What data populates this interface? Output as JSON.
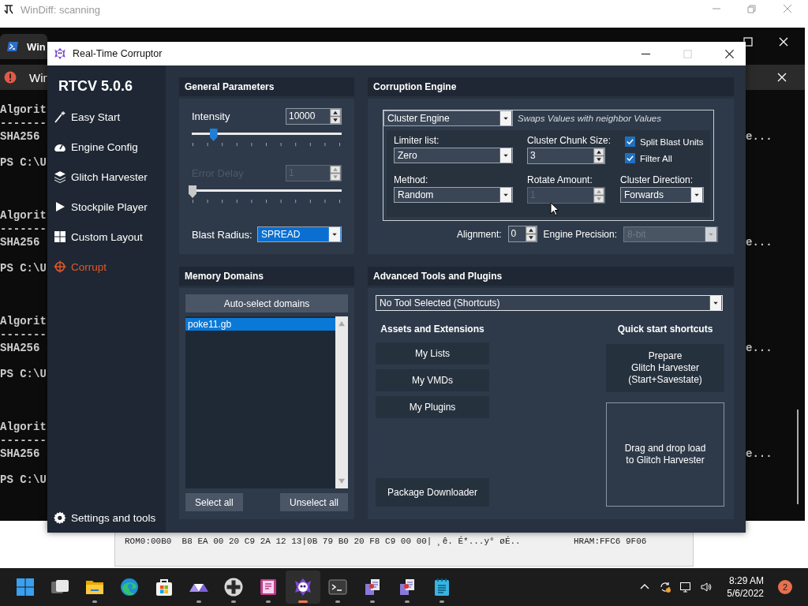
{
  "windiff": {
    "title": "WinDiff: scanning",
    "hex_line": "ROM0:00B0  B8 EA 00 20 C9 2A 12 13|0B 79 B0 20 F8 C9 00 00| ¸ê. É*...y° øÉ..",
    "register": "HRAM:FFC6 9F06"
  },
  "terminal": {
    "tab": "Win",
    "notice": "Win",
    "blocks": [
      {
        "header": "Algorit",
        "rule": "-------",
        "hash": "SHA256",
        "hash_end": "e...",
        "prompt": "PS C:\\U"
      },
      {
        "header": "Algorit",
        "rule": "-------",
        "hash": "SHA256",
        "hash_end": "e...",
        "prompt": "PS C:\\U"
      },
      {
        "header": "Algorit",
        "rule": "-------",
        "hash": "SHA256",
        "hash_end": "e...",
        "prompt": "PS C:\\U"
      },
      {
        "header": "Algorit",
        "rule": "-------",
        "hash": "SHA256",
        "hash_end": "e...",
        "prompt": "PS C:\\U"
      }
    ]
  },
  "rtcv": {
    "title": "Real-Time Corruptor",
    "version": "RTCV 5.0.6",
    "nav": [
      {
        "label": "Easy Start",
        "kind": "wand",
        "selected": false
      },
      {
        "label": "Engine Config",
        "kind": "gauge",
        "selected": false
      },
      {
        "label": "Glitch Harvester",
        "kind": "layers",
        "selected": false
      },
      {
        "label": "Stockpile Player",
        "kind": "play",
        "selected": false
      },
      {
        "label": "Custom Layout",
        "kind": "grid",
        "selected": false
      },
      {
        "label": "Corrupt",
        "kind": "crosshair",
        "selected": true
      }
    ],
    "settings": "Settings and tools",
    "general": {
      "title": "General Parameters",
      "sliders": [
        {
          "label": "Intensity",
          "value": "10000",
          "level": 0.14,
          "disabled": false
        },
        {
          "label": "Error Delay",
          "value": "1",
          "level": 0,
          "disabled": true
        }
      ],
      "blast_radius": {
        "label": "Blast Radius:",
        "value": "SPREAD",
        "focused": true
      }
    },
    "engine": {
      "title": "Corruption Engine",
      "engine": "Cluster Engine",
      "description": "Swaps Values with neighbor Values",
      "fields": [
        {
          "kind": "dropdown",
          "label": "Limiter list:",
          "value": "Zero",
          "disabled": false
        },
        {
          "kind": "spin",
          "label": "Cluster Chunk Size:",
          "value": "3",
          "disabled": false
        },
        {
          "kind": "checkboxes",
          "items": [
            {
              "label": "Split Blast Units",
              "checked": true
            },
            {
              "label": "Filter All",
              "checked": true
            }
          ]
        },
        {
          "kind": "dropdown",
          "label": "Method:",
          "value": "Random",
          "disabled": false
        },
        {
          "kind": "spin",
          "label": "Rotate Amount:",
          "value": "1",
          "disabled": true
        },
        {
          "kind": "dropdown",
          "label": "Cluster Direction:",
          "value": "Forwards",
          "disabled": false
        }
      ],
      "alignment": {
        "label": "Alignment:",
        "value": "0"
      },
      "precision": {
        "label": "Engine Precision:",
        "value": "8-bit",
        "disabled": true
      }
    },
    "memory": {
      "title": "Memory Domains",
      "auto_button": "Auto-select domains",
      "domains": [
        {
          "name": "poke11.gb",
          "selected": true
        }
      ],
      "buttons": [
        "Select all",
        "Unselect all"
      ]
    },
    "advanced": {
      "title": "Advanced Tools and Plugins",
      "tool": "No Tool Selected (Shortcuts)",
      "assets_heading": "Assets and Extensions",
      "assets": [
        "My Lists",
        "My VMDs",
        "My Plugins"
      ],
      "downloader": "Package Downloader",
      "shortcuts_heading": "Quick start shortcuts",
      "prepare": "Prepare\nGlitch Harvester\n(Start+Savestate)",
      "dropzone": "Drag and drop load\nto Glitch Harvester"
    }
  },
  "taskbar": {
    "apps": [
      {
        "kind": "start",
        "running": false,
        "selected": false
      },
      {
        "kind": "taskview",
        "running": false,
        "selected": false
      },
      {
        "kind": "folder",
        "running": true,
        "selected": false
      },
      {
        "kind": "browser",
        "running": false,
        "selected": false
      },
      {
        "kind": "store",
        "running": false,
        "selected": false
      },
      {
        "kind": "triangles",
        "running": true,
        "selected": false
      },
      {
        "kind": "gamepad",
        "running": true,
        "selected": false
      },
      {
        "kind": "notes",
        "running": true,
        "selected": false
      },
      {
        "kind": "rtcv",
        "running": true,
        "selected": true
      },
      {
        "kind": "terminal",
        "running": true,
        "selected": false
      },
      {
        "kind": "compare",
        "running": true,
        "selected": false
      },
      {
        "kind": "compare",
        "running": true,
        "selected": false
      },
      {
        "kind": "notepad",
        "running": true,
        "selected": false
      }
    ],
    "time": "8:29 AM",
    "date": "5/6/2022",
    "notifications": "2"
  }
}
